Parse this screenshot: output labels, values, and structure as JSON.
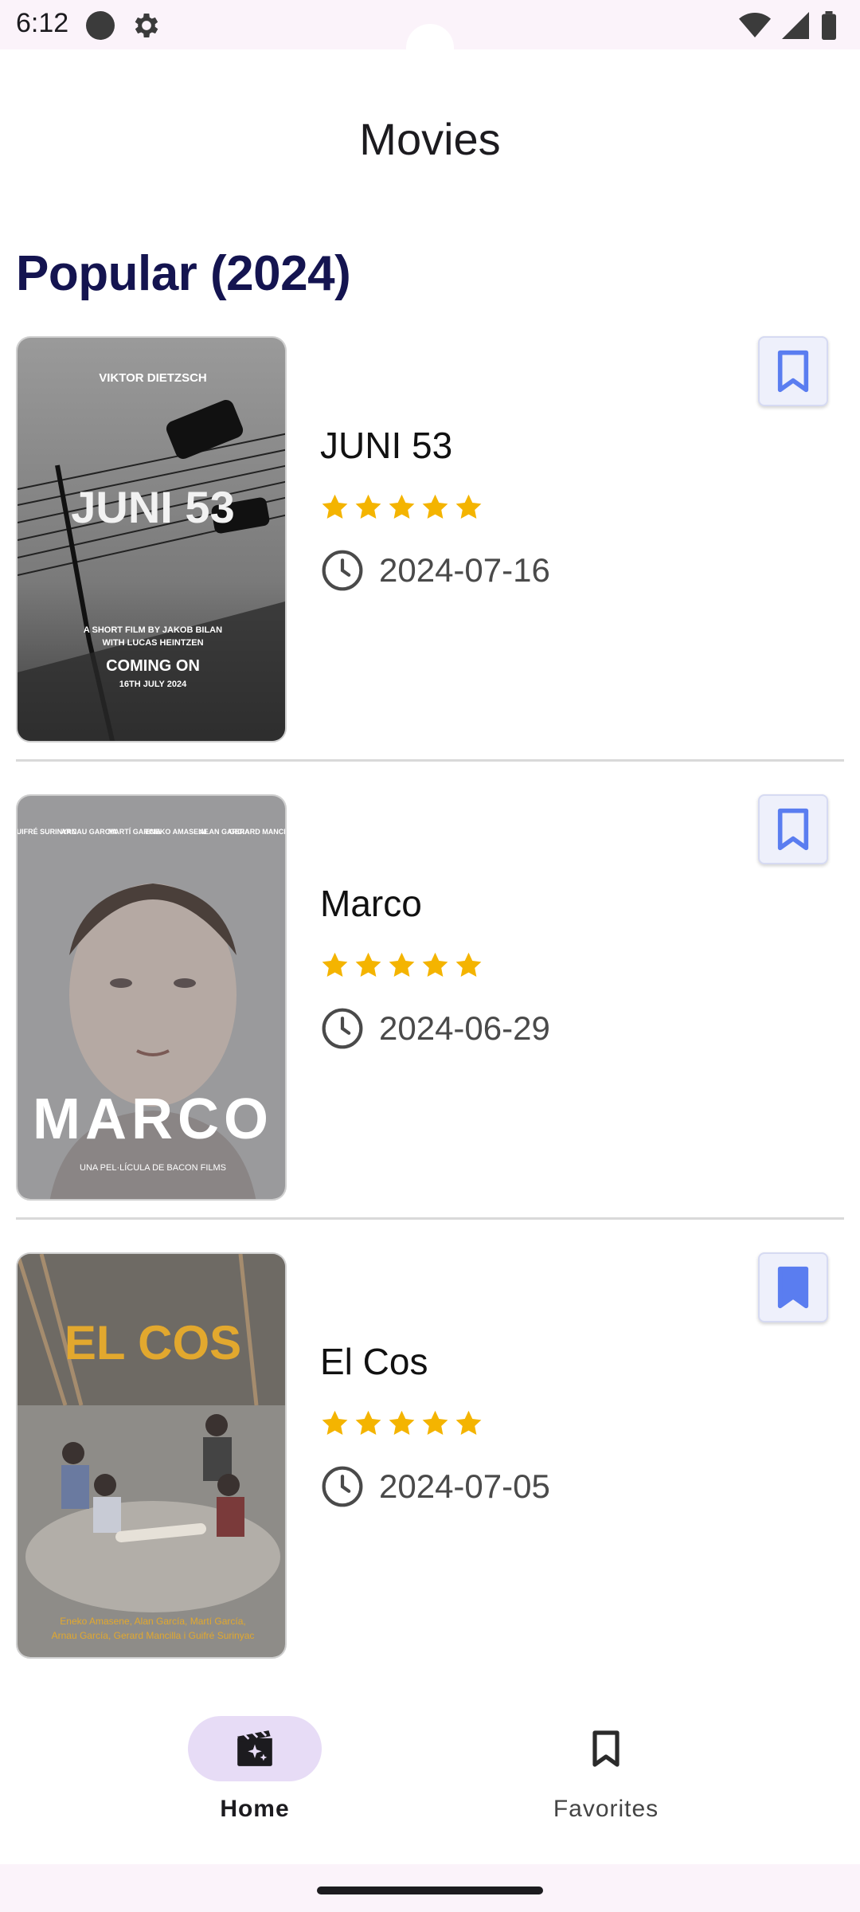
{
  "status_bar": {
    "time": "6:12"
  },
  "app": {
    "title": "Movies"
  },
  "section": {
    "title": "Popular (2024)"
  },
  "movies": [
    {
      "title": "JUNI 53",
      "rating": 5,
      "release_date": "2024-07-16",
      "bookmarked": false,
      "poster": {
        "top": "VIKTOR DIETZSCH",
        "main": "JUNI 53",
        "line1": "A SHORT FILM BY JAKOB BILAN",
        "line2": "WITH LUCAS HEINTZEN",
        "line3": "COMING ON",
        "line4": "16TH JULY 2024"
      }
    },
    {
      "title": "Marco",
      "rating": 5,
      "release_date": "2024-06-29",
      "bookmarked": false,
      "poster": {
        "cast": [
          "GUIFRÉ SURINYAC",
          "ARNAU GARCIA",
          "MARTÍ GARCIA",
          "ENEKO AMASENE",
          "ALAN GARCIA",
          "GERARD MANCILLA"
        ],
        "main": "MARCO",
        "sub": "UNA PEL·LÍCULA DE BACON FILMS"
      }
    },
    {
      "title": "El Cos",
      "rating": 5,
      "release_date": "2024-07-05",
      "bookmarked": true,
      "poster": {
        "main": "EL COS",
        "credits1": "Eneko Amasene, Alan García, Martí García,",
        "credits2": "Arnau García, Gerard Mancilla i Guifré Surinyac"
      }
    }
  ],
  "bottom_nav": {
    "items": [
      {
        "label": "Home",
        "icon": "movie-sparkle-icon",
        "active": true
      },
      {
        "label": "Favorites",
        "icon": "bookmark-icon",
        "active": false
      }
    ]
  },
  "colors": {
    "section_title": "#141450",
    "star": "#f4b400",
    "bookmark_fill": "#5a7df0",
    "nav_active_pill": "#e7dcf6",
    "status_bar_bg": "#fbf3fa"
  }
}
